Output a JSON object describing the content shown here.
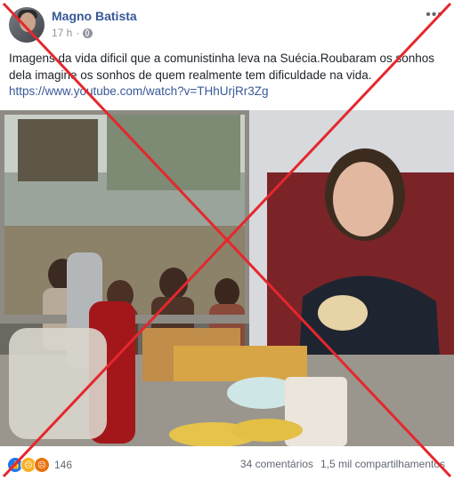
{
  "post": {
    "author": "Magno Batista",
    "time": "17 h",
    "more_label": "•••",
    "text": "Imagens da vida dificil que a comunistinha leva na Suécia.Roubaram os sonhos dela imagine os sonhos de quem realmente tem dificuldade na vida.",
    "link": "https://www.youtube.com/watch?v=THhUrjRr3Zg"
  },
  "footer": {
    "reaction_count": "146",
    "comments": "34 comentários",
    "shares": "1,5 mil compartilhamentos"
  },
  "icons": [
    "globe-icon",
    "like-reaction-icon",
    "sad-reaction-icon",
    "angry-reaction-icon"
  ],
  "colors": {
    "link": "#385898",
    "cross": "#e5272d"
  }
}
